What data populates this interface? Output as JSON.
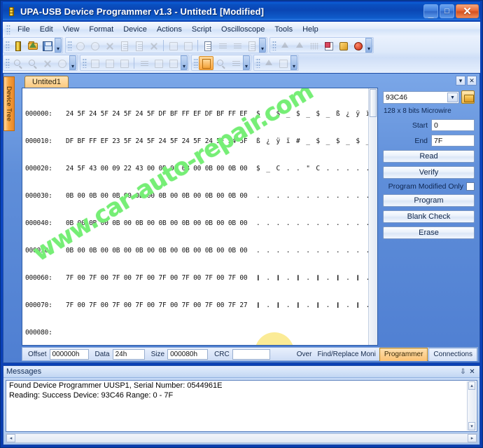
{
  "window": {
    "title": "UPA-USB Device Programmer v1.3 - Untited1 [Modified]",
    "icon": "chip-icon",
    "minimize_label": "_",
    "maximize_label": "□",
    "close_label": "✕"
  },
  "menu": {
    "items": [
      {
        "label": "File"
      },
      {
        "label": "Edit"
      },
      {
        "label": "View"
      },
      {
        "label": "Format"
      },
      {
        "label": "Device"
      },
      {
        "label": "Actions"
      },
      {
        "label": "Script"
      },
      {
        "label": "Oscilloscope"
      },
      {
        "label": "Tools"
      },
      {
        "label": "Help"
      }
    ]
  },
  "toolbar": {
    "row1_group1": [
      "chip-icon",
      "open-folder-icon",
      "save-disk-icon"
    ],
    "row1_group2": [
      "undo-icon",
      "redo-icon",
      "cut-icon",
      "copy-icon",
      "paste-icon",
      "delete-x-icon",
      "fill-icon",
      "invert-icon",
      "document-icon",
      "insert-icon",
      "compare-icon",
      "checksum-icon"
    ],
    "row1_group3": [
      "upload-icon",
      "download-icon",
      "grid-icon",
      "note-icon",
      "settings-wrench-icon",
      "bug-icon"
    ],
    "row2_group1": [
      "zoom-in-icon",
      "zoom-out-icon",
      "shuffle-icon",
      "refresh-icon"
    ],
    "row2_group2": [
      "view1-icon",
      "view2-icon",
      "view3-icon",
      "list-icon",
      "table-icon",
      "columns-icon"
    ],
    "row2_group3": [
      "page-view-icon",
      "find-icon",
      "replace-icon"
    ],
    "row2_group4": [
      "run-script-icon",
      "stop-icon"
    ]
  },
  "devtree": {
    "label": "Device Tree"
  },
  "tabs": {
    "document_tab": "Untited1",
    "list_button": "▾",
    "close_button": "✕"
  },
  "hex": {
    "rows": [
      {
        "offset": "000000:",
        "bytes": "24 5F 24 5F 24 5F 24 5F DF BF FF EF DF BF FF EF",
        "ascii": "$ _ $ _ $ _ $ _ ß ¿ ÿ ï ß ¿ ÿ ï"
      },
      {
        "offset": "000010:",
        "bytes": "DF BF FF EF 23 5F 24 5F 24 5F 24 5F 24 5F 24 5F",
        "ascii": "ß ¿ ÿ ï # _ $ _ $ _ $ _ $ _ $ _"
      },
      {
        "offset": "000020:",
        "bytes": "24 5F 43 00 09 22 43 00 0B 00 0B 00 0B 00 0B 00",
        "ascii": "$ _ C . . \" C . . . . . . . . ."
      },
      {
        "offset": "000030:",
        "bytes": "0B 00 0B 00 0B 00 0B 00 0B 00 0B 00 0B 00 0B 00",
        "ascii": ". . . . . . . . . . . . . . . ."
      },
      {
        "offset": "000040:",
        "bytes": "0B 00 0B 00 0B 00 0B 00 0B 00 0B 00 0B 00 0B 00",
        "ascii": ". . . . . . . . . . . . . . . ."
      },
      {
        "offset": "000050:",
        "bytes": "0B 00 0B 00 0B 00 0B 00 0B 00 0B 00 0B 00 0B 00",
        "ascii": ". . . . . . . . . . . . . . . ."
      },
      {
        "offset": "000060:",
        "bytes": "7F 00 7F 00 7F 00 7F 00 7F 00 7F 00 7F 00 7F 00",
        "ascii": "❙ . ❙ . ❙ . ❙ . ❙ . ❙ . ❙ . ❙ ."
      },
      {
        "offset": "000070:",
        "bytes": "7F 00 7F 00 7F 00 7F 00 7F 00 7F 00 7F 00 7F 27",
        "ascii": "❙ . ❙ . ❙ . ❙ . ❙ . ❙ . ❙ . ❙ '"
      },
      {
        "offset": "000080:",
        "bytes": "",
        "ascii": ""
      }
    ]
  },
  "watermark": {
    "text": "www.car-auto-repair.com",
    "color": "#76ee76",
    "dot_color": "#fbeb96"
  },
  "hex_status": {
    "offset_label": "Offset",
    "offset_value": "000000h",
    "data_label": "Data",
    "data_value": "24h",
    "size_label": "Size",
    "size_value": "000080h",
    "crc_label": "CRC",
    "crc_value": "",
    "mode_label": "Over",
    "findreplace_label": "Find/Replace Moni",
    "tabs": [
      {
        "label": "Programmer",
        "selected": true
      },
      {
        "label": "Connections",
        "selected": false
      }
    ]
  },
  "programmer": {
    "device_value": "93C46",
    "device_dropdown_arrow": "▼",
    "open_button": "open-device-icon",
    "device_description": "128 x 8 bits Microwire",
    "start_label": "Start",
    "start_value": "0",
    "end_label": "End",
    "end_value": "7F",
    "read_button": "Read",
    "verify_button": "Verify",
    "program_modified_only_label": "Program Modified Only",
    "program_modified_only_checked": false,
    "program_button": "Program",
    "blank_check_button": "Blank Check",
    "erase_button": "Erase"
  },
  "messages": {
    "title": "Messages",
    "pin_button": "⇩",
    "close_button": "✕",
    "lines": [
      "Found Device Programmer UUSP1, Serial Number: 0544961E",
      "Reading: Success  Device: 93C46 Range: 0 - 7F"
    ],
    "scroll_up": "▴",
    "scroll_down": "▾",
    "scroll_left": "◂",
    "scroll_right": "▸"
  }
}
